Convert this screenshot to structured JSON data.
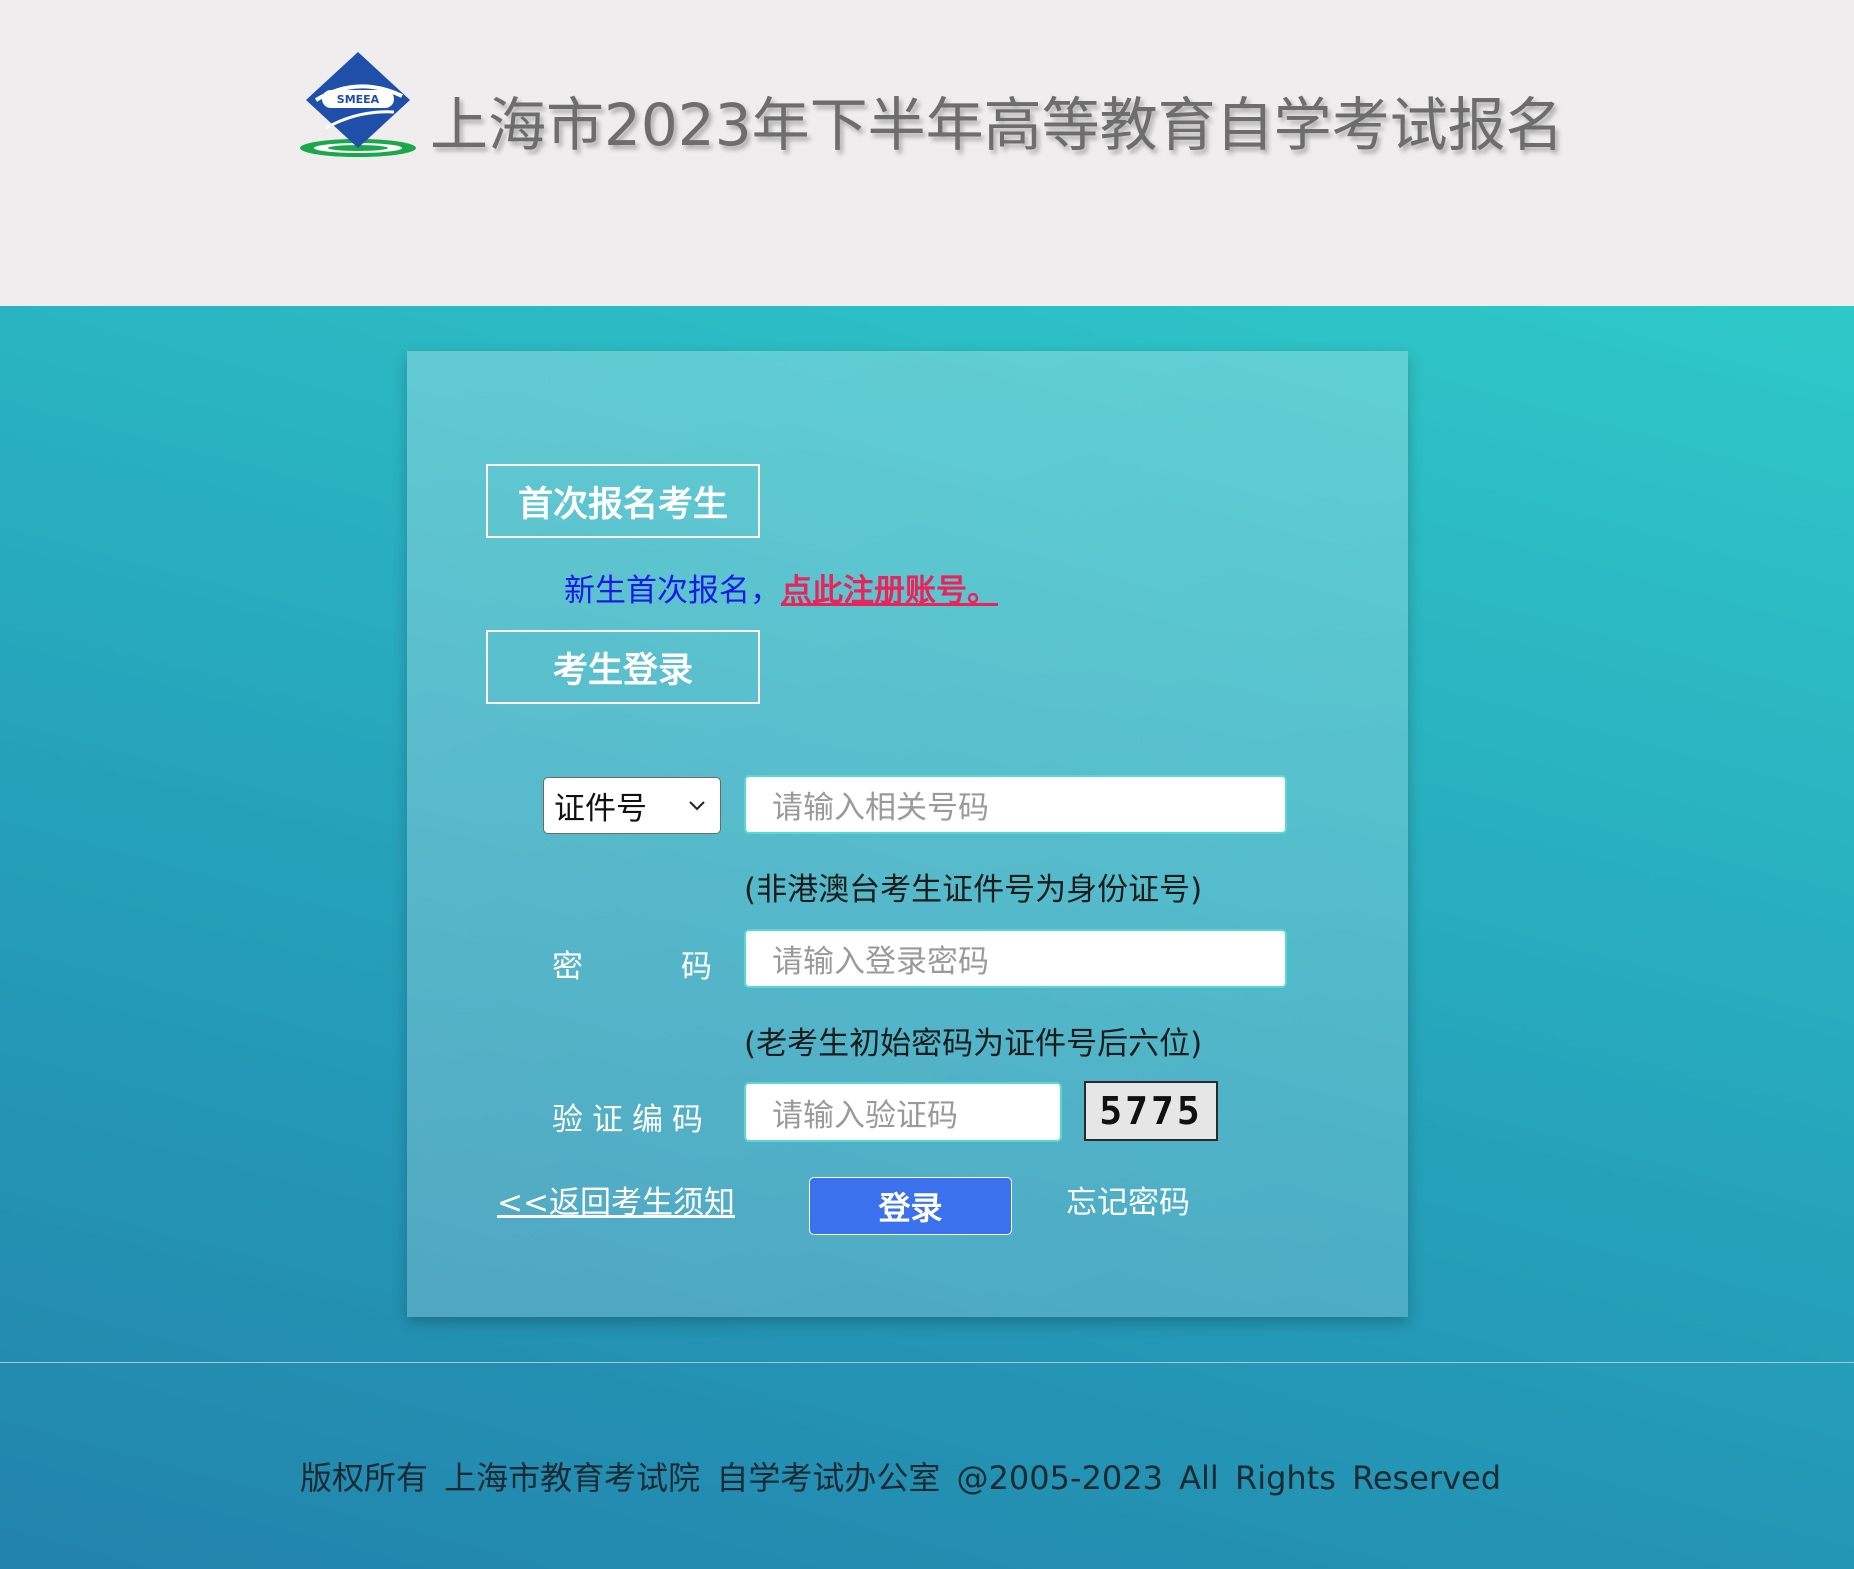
{
  "header": {
    "title": "上海市2023年下半年高等教育自学考试报名",
    "logo_text": "SMEEA"
  },
  "first_time": {
    "section_title": "首次报名考生",
    "prompt": "新生首次报名，",
    "register_link": "点此注册账号。"
  },
  "login": {
    "section_title": "考生登录",
    "id_type_selected": "证件号",
    "id_placeholder": "请输入相关号码",
    "id_hint": "(非港澳台考生证件号为身份证号)",
    "password_label_a": "密",
    "password_label_b": "码",
    "password_placeholder": "请输入登录密码",
    "password_hint": "(老考生初始密码为证件号后六位)",
    "captcha_label": "验证编码",
    "captcha_placeholder": "请输入验证码",
    "captcha_value": "5775",
    "back_link": "<<返回考生须知",
    "login_button": "登录",
    "forgot_link": "忘记密码"
  },
  "footer": {
    "text": "版权所有   上海市教育考试院  自学考试办公室    @2005-2023  All  Rights  Reserved"
  },
  "colors": {
    "accent_button": "#3b71ec",
    "register_link": "#e8245a",
    "prompt_text": "#1a1ae8",
    "input_border": "#58d8d2"
  }
}
